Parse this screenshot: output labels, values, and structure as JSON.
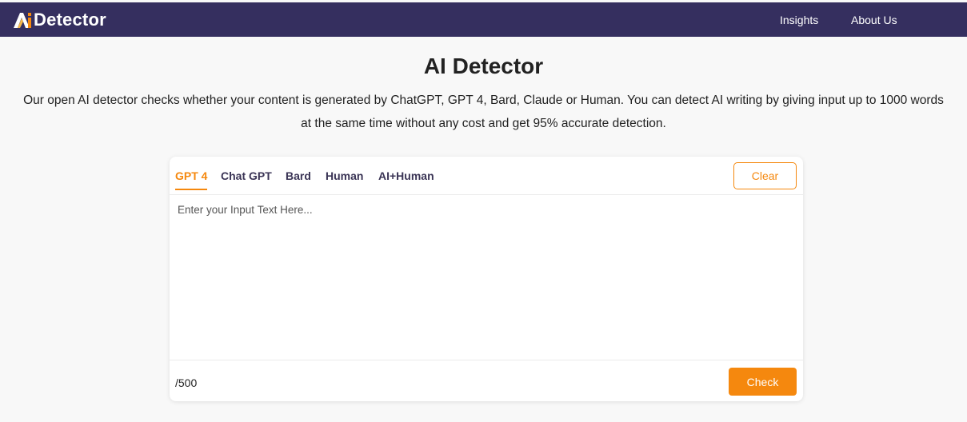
{
  "brand": {
    "logo_glyph": "Ai",
    "name": "Detector",
    "accent": "#f5880e",
    "nav_color": "#352f5f"
  },
  "nav": {
    "insights": "Insights",
    "about": "About Us"
  },
  "hero": {
    "title": "AI Detector",
    "description_line1": "Our open AI detector checks whether your content is generated by ChatGPT, GPT 4, Bard, Claude or Human. You can detect AI writing by giving input up to 1000 words",
    "description_line2": "at the same time without any cost and get 95% accurate detection."
  },
  "detector": {
    "tabs": [
      {
        "label": "GPT 4",
        "active": true
      },
      {
        "label": "Chat GPT",
        "active": false
      },
      {
        "label": "Bard",
        "active": false
      },
      {
        "label": "Human",
        "active": false
      },
      {
        "label": "AI+Human",
        "active": false
      }
    ],
    "clear_label": "Clear",
    "input_placeholder": "Enter your Input Text Here...",
    "input_value": "",
    "word_count": "/500",
    "check_label": "Check"
  }
}
